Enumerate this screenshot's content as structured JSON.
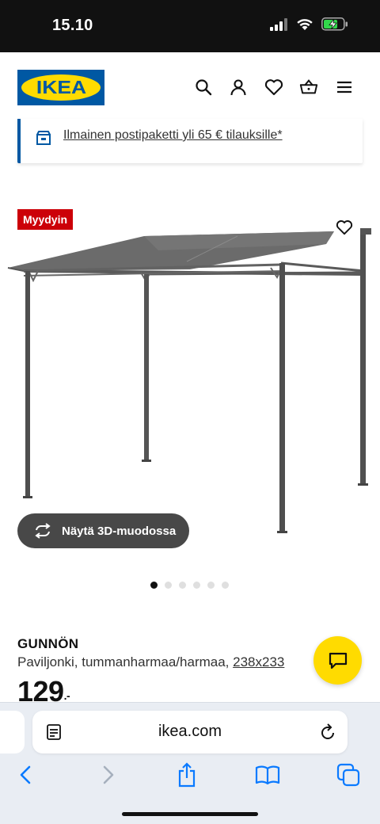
{
  "status_bar": {
    "time": "15.10"
  },
  "header": {
    "logo_text": "IKEA",
    "icons": [
      "search-icon",
      "account-icon",
      "heart-icon",
      "basket-icon",
      "menu-icon"
    ]
  },
  "shipping_banner": {
    "text": "Ilmainen postipaketti yli 65 € tilauksille*"
  },
  "product": {
    "badge": "Myydyin",
    "view_3d_label": "Näytä 3D-muodossa",
    "name": "GUNNÖN",
    "description_prefix": "Paviljonki, tummanharmaa/harmaa, ",
    "description_size": "238x233",
    "price_main": "129",
    "price_suffix": ".-",
    "carousel": {
      "count": 6,
      "active": 0
    }
  },
  "browser": {
    "url": "ikea.com",
    "toolbar": [
      "back-icon",
      "forward-icon",
      "share-icon",
      "bookmarks-icon",
      "tabs-icon"
    ]
  },
  "colors": {
    "ikea_blue": "#0058a3",
    "ikea_yellow": "#ffdb00",
    "badge_red": "#cc0008",
    "ios_blue": "#0a7aff"
  }
}
